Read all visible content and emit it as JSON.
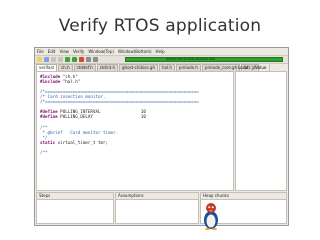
{
  "slide": {
    "title": "Verify RTOS application"
  },
  "menubar": [
    "File",
    "Edit",
    "View",
    "Verify",
    "Window(Top)",
    "Window(Bottom)",
    "Help"
  ],
  "progress_text": "ahaha ahhk ahb akakak ahk",
  "tabs": [
    "verifast",
    "ch.h",
    "stddef.h",
    "stdint.h",
    "ghost-chibios.gh",
    "hal.h",
    "prelude.h",
    "prelude_core.gh",
    "list.gh"
  ],
  "local_panel": {
    "col1": "Local",
    "col2": "Value"
  },
  "code": {
    "line1_kw": "#include",
    "line1_rest": " \"ch.h\"",
    "line2_kw": "#include",
    "line2_rest": " \"hal.h\"",
    "line3": "/*=============================================================",
    "line4": "/* Card insection monitor.",
    "line5": "/*=============================================================",
    "line6_kw": "#define",
    "line6_rest": " POLLING_INTERVAL                10",
    "line7_kw": "#define",
    "line7_rest": " POLLING_DELAY                   10",
    "line8": "/**",
    "line9": " * @brief   Card monitor timer.",
    "line10": " */",
    "line11_kw": "static",
    "line11_rest": " virtual_timer_t tmr;",
    "line12": "/**"
  },
  "panels": {
    "steps": "Steps",
    "assumptions": "Assumptions",
    "heap": "Heap chunks"
  },
  "colors": {
    "progress": "#2ea02e",
    "keyword": "#7a0a6e",
    "comment": "#2f5fa8"
  }
}
